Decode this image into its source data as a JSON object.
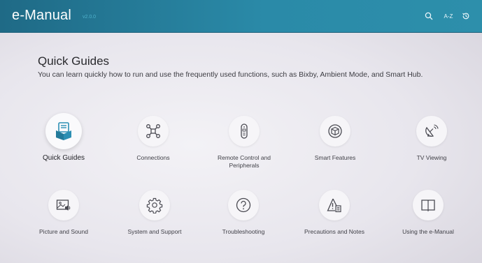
{
  "header": {
    "title": "e-Manual",
    "version": "v2.0.0",
    "icons": [
      "search-icon",
      "az-sort-icon",
      "history-icon"
    ],
    "az_label": "A-Z"
  },
  "section": {
    "title": "Quick Guides",
    "description": "You can learn quickly how to run and use the frequently used functions, such as Bixby, Ambient Mode, and Smart Hub."
  },
  "menu": {
    "items": [
      {
        "label": "Quick Guides",
        "icon": "quick-guides-icon",
        "selected": true
      },
      {
        "label": "Connections",
        "icon": "connections-icon"
      },
      {
        "label": "Remote Control and Peripherals",
        "icon": "remote-control-icon"
      },
      {
        "label": "Smart Features",
        "icon": "smart-features-icon"
      },
      {
        "label": "TV Viewing",
        "icon": "tv-viewing-icon"
      },
      {
        "label": "Picture and Sound",
        "icon": "picture-sound-icon"
      },
      {
        "label": "System and Support",
        "icon": "gear-icon"
      },
      {
        "label": "Troubleshooting",
        "icon": "question-icon"
      },
      {
        "label": "Precautions and Notes",
        "icon": "warning-icon"
      },
      {
        "label": "Using the e-Manual",
        "icon": "book-icon"
      }
    ]
  },
  "colors": {
    "header_bar": "#2a8aa8",
    "accent_selected": "#2c8fb3",
    "background": "#e9e7ee"
  }
}
